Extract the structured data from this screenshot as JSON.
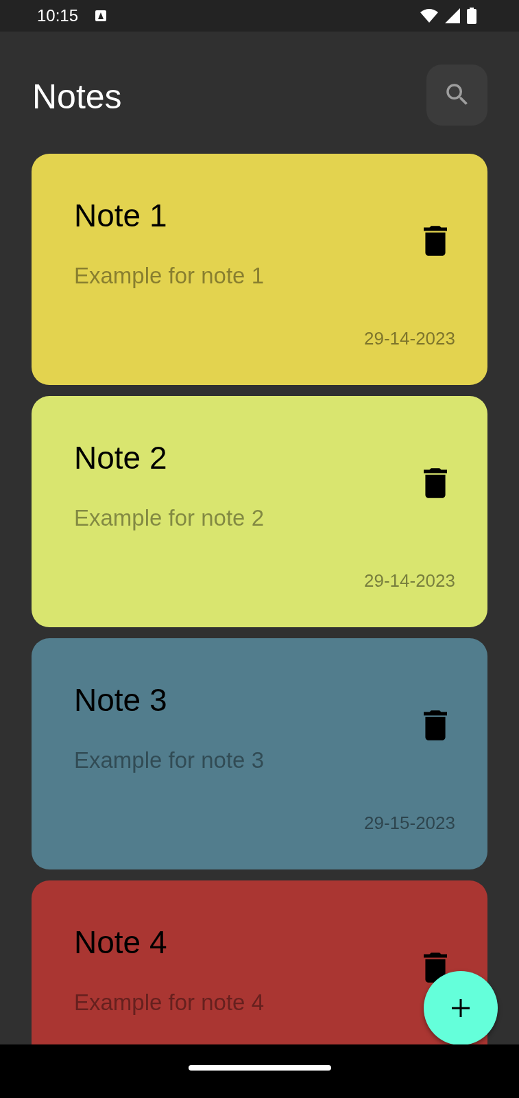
{
  "status_bar": {
    "time": "10:15"
  },
  "header": {
    "title": "Notes"
  },
  "notes": [
    {
      "title": "Note 1",
      "text": "Example for note 1",
      "date": "29-14-2023",
      "color": "#e3d34f"
    },
    {
      "title": "Note 2",
      "text": "Example for note 2",
      "date": "29-14-2023",
      "color": "#d9e56f"
    },
    {
      "title": "Note 3",
      "text": "Example for note 3",
      "date": "29-15-2023",
      "color": "#527d8d"
    },
    {
      "title": "Note 4",
      "text": "Example for note 4",
      "color": "#aa3632"
    }
  ]
}
